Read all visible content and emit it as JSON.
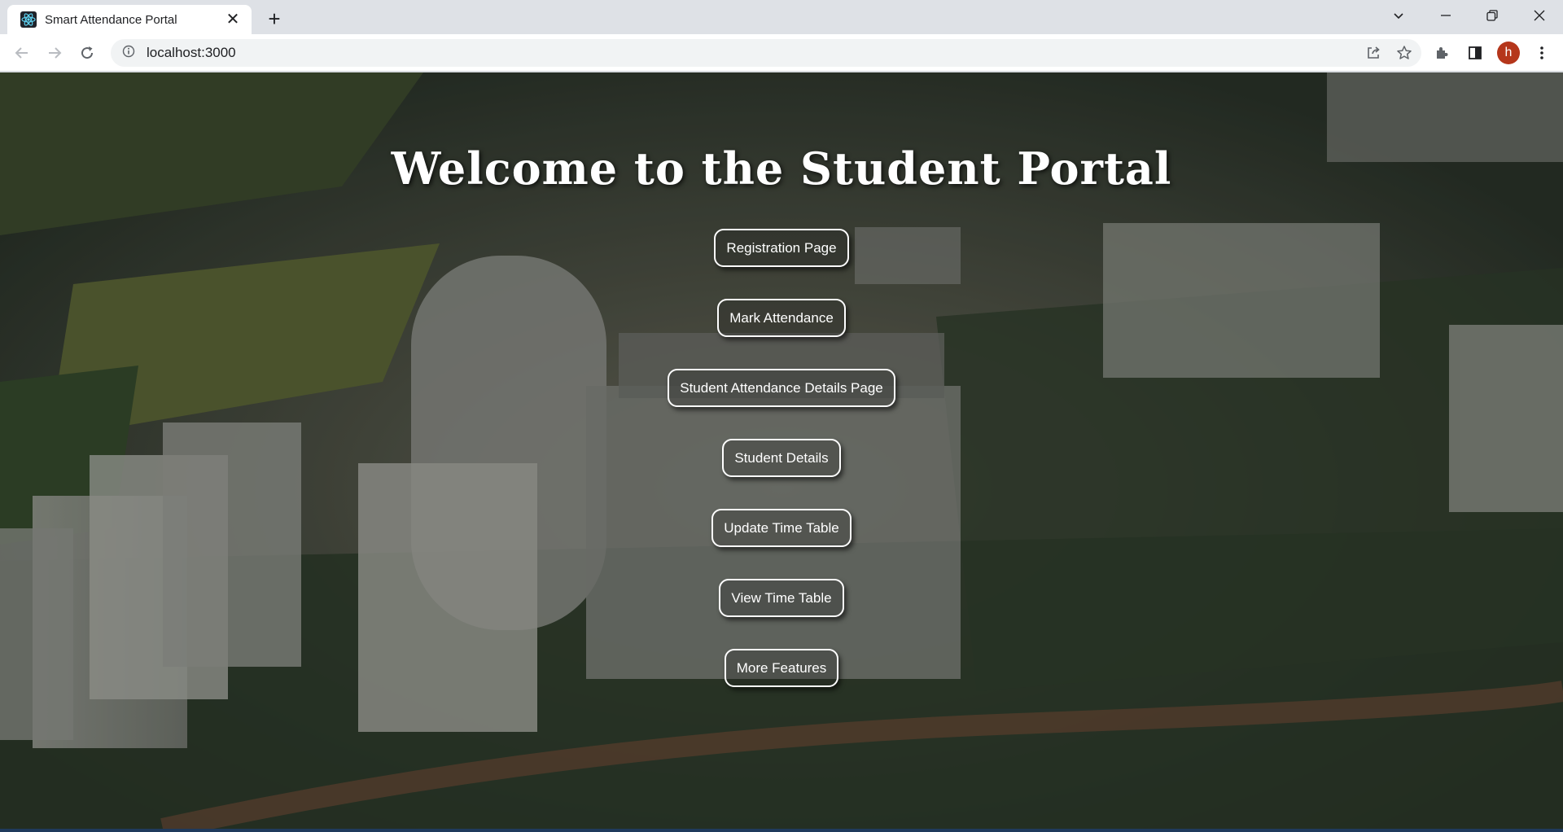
{
  "browser": {
    "tab_title": "Smart Attendance Portal",
    "tab_close": "✕",
    "new_tab": "+",
    "url": "localhost:3000",
    "profile_initial": "h",
    "icons": [
      "react-favicon",
      "back-arrow-icon",
      "forward-arrow-icon",
      "reload-icon",
      "info-icon",
      "share-icon",
      "star-icon",
      "extensions-icon",
      "side-panel-icon",
      "kebab-menu-icon",
      "tab-search-icon",
      "minimize-icon",
      "restore-icon",
      "close-icon"
    ]
  },
  "page": {
    "title": "Welcome to the Student Portal",
    "buttons": [
      {
        "label": "Registration Page"
      },
      {
        "label": "Mark Attendance"
      },
      {
        "label": "Student Attendance Details Page"
      },
      {
        "label": "Student Details"
      },
      {
        "label": "Update Time Table"
      },
      {
        "label": "View Time Table"
      },
      {
        "label": "More Features"
      }
    ]
  },
  "colors": {
    "tabstrip": "#dee1e6",
    "button_border": "#ffffff",
    "avatar": "#b5361b"
  }
}
